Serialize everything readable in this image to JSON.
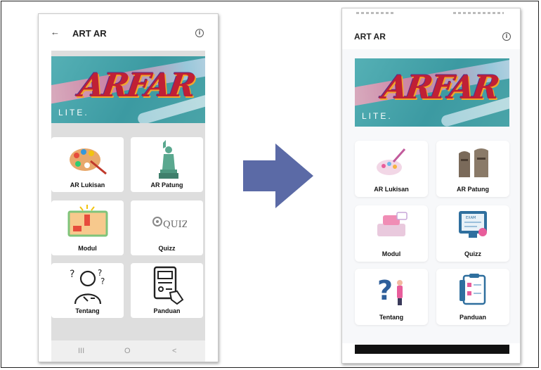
{
  "left_screen": {
    "title": "ART AR",
    "back_glyph": "←",
    "info_glyph": "i",
    "banner": {
      "logo": "ARFAR",
      "subtitle": "LITE."
    },
    "tiles": [
      {
        "label": "AR Lukisan",
        "icon": "palette-icon"
      },
      {
        "label": "AR Patung",
        "icon": "statue-icon"
      },
      {
        "label": "Modul",
        "icon": "module-board-icon"
      },
      {
        "label": "Quizz",
        "icon": "quiz-icon",
        "icon_text": "QUIZ"
      },
      {
        "label": "Tentang",
        "icon": "thinking-person-icon"
      },
      {
        "label": "Panduan",
        "icon": "guide-document-icon"
      }
    ],
    "nav": {
      "recents": "III",
      "home": "O",
      "back": "<"
    }
  },
  "right_screen": {
    "title": "ART AR",
    "info_glyph": "i",
    "banner": {
      "logo": "ARFAR",
      "subtitle": "LITE."
    },
    "tiles": [
      {
        "label": "AR Lukisan",
        "icon": "palette-brush-icon"
      },
      {
        "label": "AR Patung",
        "icon": "moai-statue-icon"
      },
      {
        "label": "Modul",
        "icon": "chat-book-icon"
      },
      {
        "label": "Quizz",
        "icon": "exam-monitor-icon",
        "icon_text": "EXAM"
      },
      {
        "label": "Tentang",
        "icon": "question-person-icon"
      },
      {
        "label": "Panduan",
        "icon": "checklist-icon"
      }
    ]
  },
  "colors": {
    "arrow": "#5b6aa6",
    "banner_teal": "#4aa4a8",
    "logo_red": "#c02035",
    "left_bg": "#dedede",
    "right_bg": "#f7f8fa"
  }
}
